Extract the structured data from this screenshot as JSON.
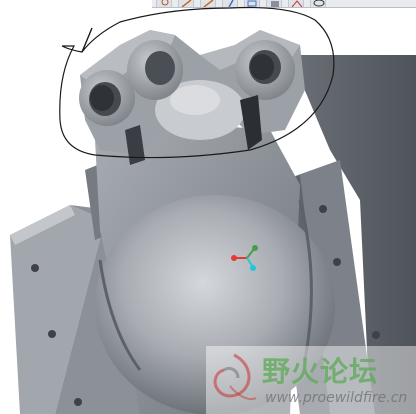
{
  "toolbar": {
    "buttons": [
      "zoom-icon",
      "sketch-icon",
      "sketch-icon",
      "plane-icon",
      "view-orient-icon",
      "layer-icon",
      "axis-icon",
      "eye-icon"
    ]
  },
  "model": {
    "body_color": "#8e939a",
    "highlight_color": "#c2c6cb",
    "shadow_color": "#5a5f66",
    "annotation_stroke_color": "#1a1a1a"
  },
  "coordinate_triad": {
    "x_color": "#e53935",
    "y_color": "#43a047",
    "z_color": "#26c6da"
  },
  "watermark": {
    "title": "野火论坛",
    "url": "www.proewildfire.cn",
    "title_color": "#5faa5a"
  }
}
